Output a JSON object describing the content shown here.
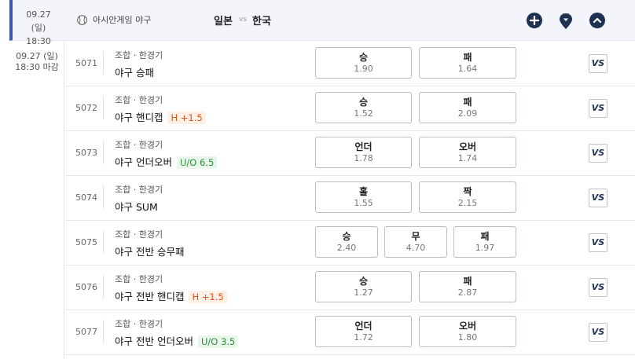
{
  "header": {
    "date": "09.27 (일)",
    "time": "18:30",
    "league": "아시안게임 야구",
    "home": "일본",
    "vs": "vs",
    "away": "한국"
  },
  "left": {
    "date": "09.27 (일)",
    "time": "18:30 마감"
  },
  "colors": {
    "accent": "#3c5aa8",
    "icon_button": "#1f3152",
    "handicap_badge": "#e0501e",
    "over_under_badge": "#2e8b3a"
  },
  "icons": [
    "baseball-icon",
    "plus-icon",
    "location-pin-icon",
    "chevron-up-icon",
    "vs-icon"
  ],
  "rows": [
    {
      "id": "5071",
      "category": "조합 · 한경기",
      "title": "야구 승패",
      "badge": "",
      "odds": [
        {
          "label": "승",
          "value": "1.90"
        },
        {
          "label": "패",
          "value": "1.64"
        }
      ],
      "vs": "VS"
    },
    {
      "id": "5072",
      "category": "조합 · 한경기",
      "title": "야구 핸디캡",
      "badge": "H +1.5",
      "odds": [
        {
          "label": "승",
          "value": "1.52"
        },
        {
          "label": "패",
          "value": "2.09"
        }
      ],
      "vs": "VS"
    },
    {
      "id": "5073",
      "category": "조합 · 한경기",
      "title": "야구 언더오버",
      "badge": "U/O 6.5",
      "odds": [
        {
          "label": "언더",
          "value": "1.78"
        },
        {
          "label": "오버",
          "value": "1.74"
        }
      ],
      "vs": "VS"
    },
    {
      "id": "5074",
      "category": "조합 · 한경기",
      "title": "야구 SUM",
      "badge": "",
      "odds": [
        {
          "label": "홀",
          "value": "1.55"
        },
        {
          "label": "짝",
          "value": "2.15"
        }
      ],
      "vs": "VS"
    },
    {
      "id": "5075",
      "category": "조합 · 한경기",
      "title": "야구 전반 승무패",
      "badge": "",
      "odds": [
        {
          "label": "승",
          "value": "2.40"
        },
        {
          "label": "무",
          "value": "4.70"
        },
        {
          "label": "패",
          "value": "1.97"
        }
      ],
      "vs": "VS"
    },
    {
      "id": "5076",
      "category": "조합 · 한경기",
      "title": "야구 전반 핸디캡",
      "badge": "H +1.5",
      "odds": [
        {
          "label": "승",
          "value": "1.27"
        },
        {
          "label": "패",
          "value": "2.87"
        }
      ],
      "vs": "VS"
    },
    {
      "id": "5077",
      "category": "조합 · 한경기",
      "title": "야구 전반 언더오버",
      "badge": "U/O 3.5",
      "odds": [
        {
          "label": "언더",
          "value": "1.72"
        },
        {
          "label": "오버",
          "value": "1.80"
        }
      ],
      "vs": "VS"
    }
  ]
}
